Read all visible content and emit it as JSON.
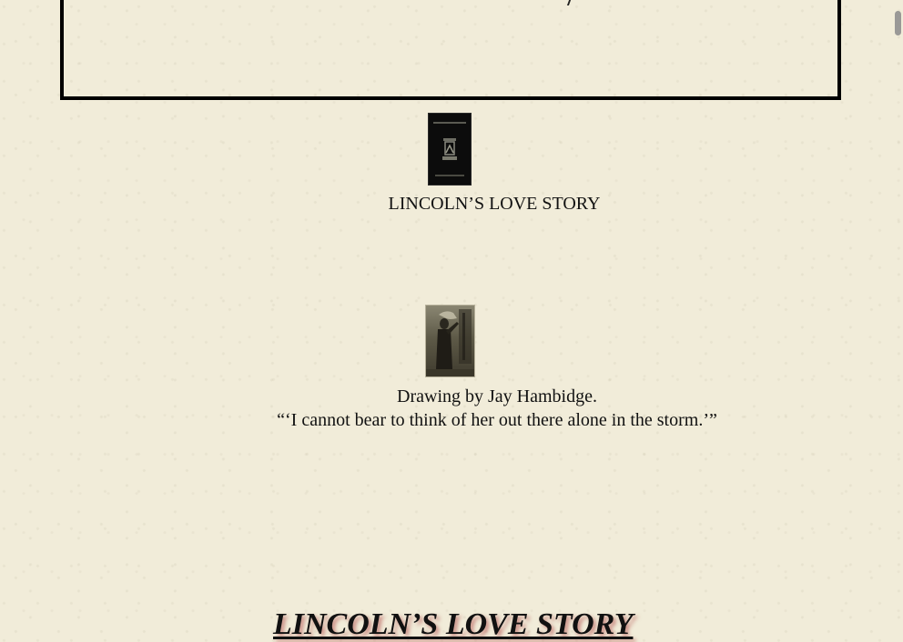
{
  "book": {
    "title_caption": "LINCOLN’S LOVE STORY",
    "cover_icon": "book-cover-icon"
  },
  "illustration": {
    "credit": "Drawing by Jay Hambidge.",
    "quote": "“‘I cannot bear to think of her out there alone in the storm.’”",
    "icon": "illustration-thumbnail-icon"
  },
  "heading": {
    "text": "LINCOLN’S LOVE STORY"
  },
  "colors": {
    "page_background": "#f1ecd9",
    "text": "#111111",
    "heading_shadow": "#aa3c3c"
  }
}
